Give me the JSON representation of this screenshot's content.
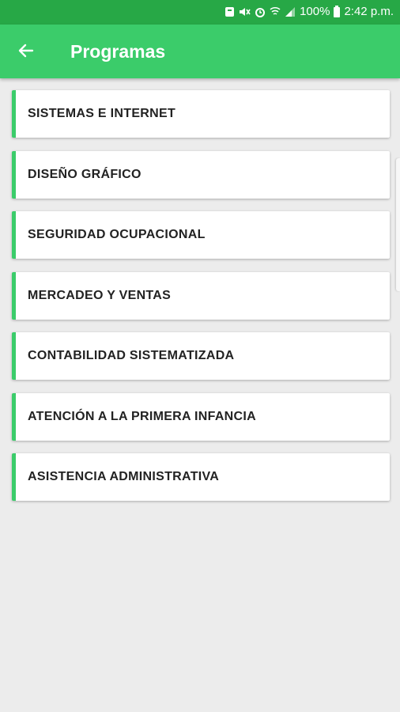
{
  "status_bar": {
    "battery": "100%",
    "time": "2:42 p.m.",
    "icons": [
      "notification-icon",
      "mute-icon",
      "alarm-icon",
      "wifi-icon",
      "signal-icon",
      "battery-icon"
    ]
  },
  "app_bar": {
    "back_icon": "arrow-back-icon",
    "title": "Programas"
  },
  "programs": [
    {
      "label": "SISTEMAS E INTERNET"
    },
    {
      "label": "DISEÑO GRÁFICO"
    },
    {
      "label": "SEGURIDAD OCUPACIONAL"
    },
    {
      "label": "MERCADEO Y VENTAS"
    },
    {
      "label": "CONTABILIDAD SISTEMATIZADA"
    },
    {
      "label": "ATENCIÓN A LA PRIMERA INFANCIA"
    },
    {
      "label": "ASISTENCIA ADMINISTRATIVA"
    }
  ],
  "colors": {
    "status_bar": "#27a846",
    "app_bar": "#3bcc6a",
    "accent": "#3bcc6a",
    "background": "#ececec"
  }
}
